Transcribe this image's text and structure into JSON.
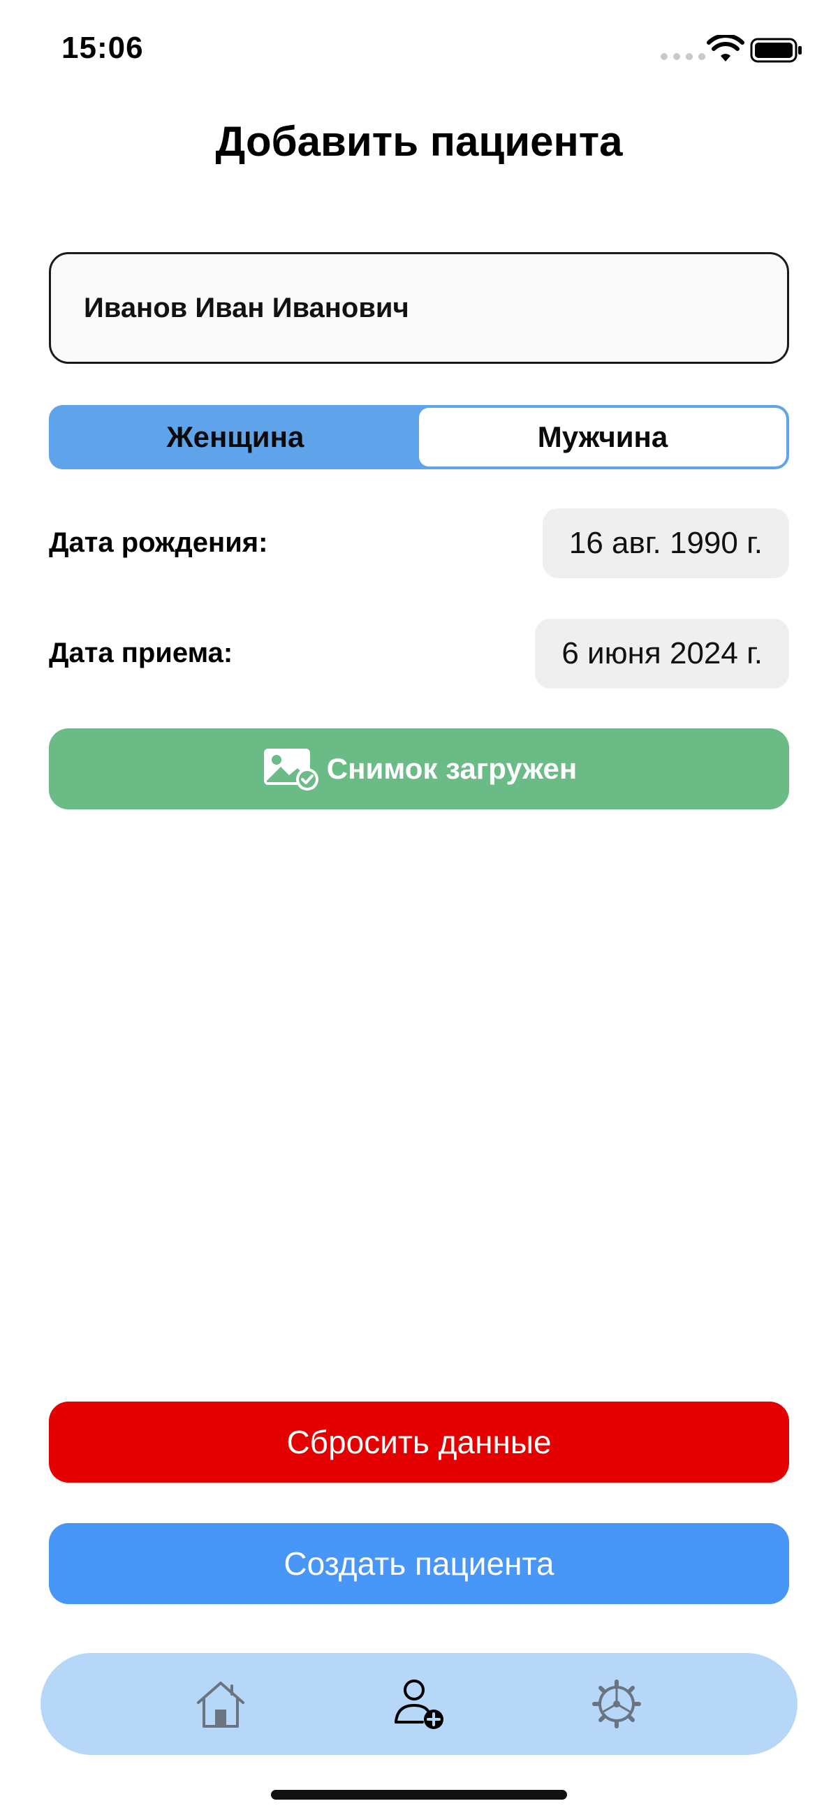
{
  "status_bar": {
    "time": "15:06",
    "icons": [
      "signal-dots-icon",
      "wifi-icon",
      "battery-icon"
    ]
  },
  "header": {
    "title": "Добавить пациента"
  },
  "form": {
    "name_value": "Иванов Иван Иванович",
    "gender": {
      "options": [
        "Женщина",
        "Мужчина"
      ],
      "selected": "Женщина"
    },
    "birth_date": {
      "label": "Дата рождения:",
      "value": "16 авг. 1990 г."
    },
    "visit_date": {
      "label": "Дата приема:",
      "value": "6 июня 2024 г."
    },
    "upload": {
      "icon": "image-check-icon",
      "label": "Снимок загружен"
    }
  },
  "actions": {
    "reset_label": "Сбросить данные",
    "create_label": "Создать пациента"
  },
  "tab_bar": {
    "tabs": [
      {
        "icon": "home-icon"
      },
      {
        "icon": "add-user-icon",
        "active": true
      },
      {
        "icon": "settings-icon"
      }
    ]
  },
  "colors": {
    "segment_selected": "#5fa3ea",
    "upload_button": "#6bbb86",
    "reset_button": "#e50000",
    "create_button": "#4896f6",
    "tab_bar": "#b7d7f8",
    "date_pill": "#efefef"
  }
}
